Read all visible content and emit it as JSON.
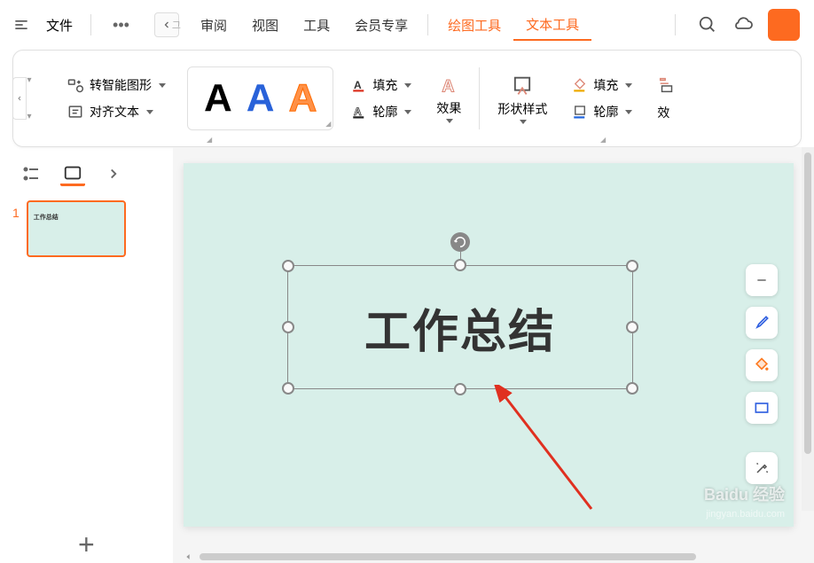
{
  "topbar": {
    "file_label": "文件",
    "tabs": {
      "review": "审阅",
      "view": "视图",
      "tools": "工具",
      "member": "会员专享",
      "draw_tools": "绘图工具",
      "text_tools": "文本工具"
    }
  },
  "ribbon": {
    "smart_shape": "转智能图形",
    "align_text": "对齐文本",
    "fill": "填充",
    "outline": "轮廓",
    "effect": "效果",
    "shape_style": "形状样式",
    "fill2": "填充",
    "outline2": "轮廓",
    "effect2": "效"
  },
  "sidebar": {
    "slides": [
      {
        "number": "1",
        "thumb_text": "工作总结"
      }
    ]
  },
  "canvas": {
    "text_content": "工作总结"
  },
  "watermark": {
    "brand": "Baidu 经验",
    "url": "jingyan.baidu.com"
  }
}
